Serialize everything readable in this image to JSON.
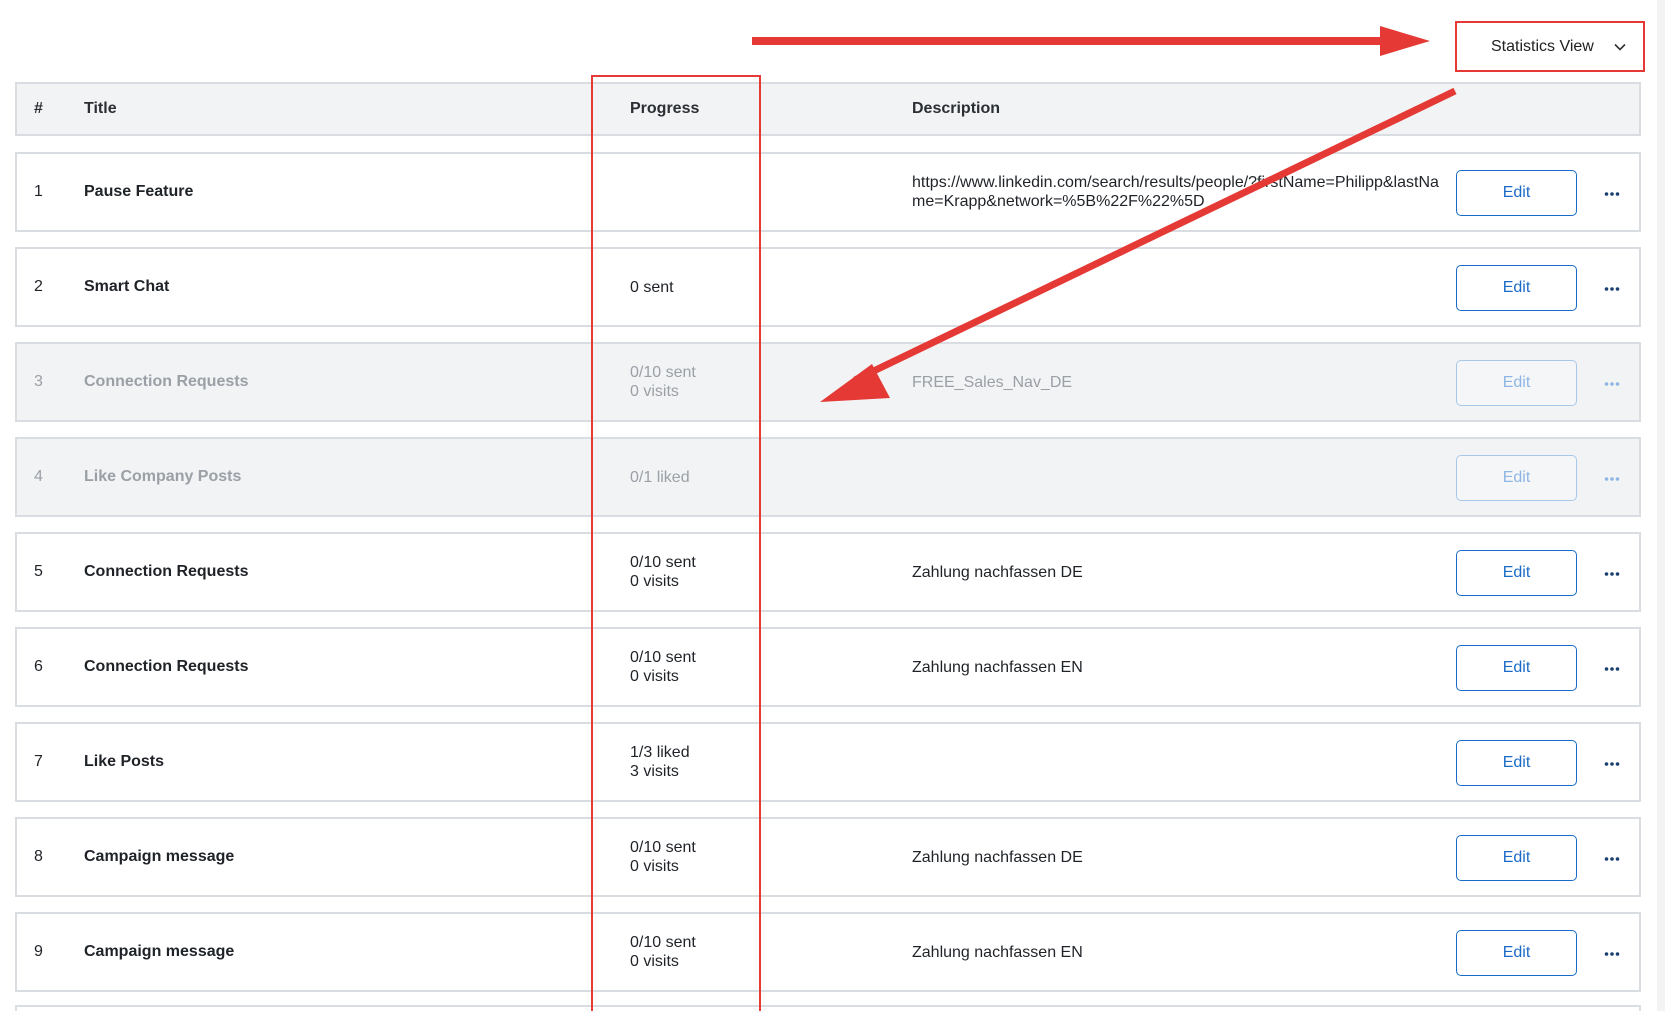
{
  "view_select": {
    "label": "Statistics View"
  },
  "table": {
    "headers": {
      "num": "#",
      "title": "Title",
      "progress": "Progress",
      "description": "Description"
    },
    "edit_label": "Edit",
    "rows": [
      {
        "num": "1",
        "title": "Pause Feature",
        "progress_line1": "",
        "progress_line2": "",
        "description": "https://www.linkedin.com/search/results/people/?firstName=Philipp&lastName=Krapp&network=%5B%22F%22%5D",
        "state": "active"
      },
      {
        "num": "2",
        "title": "Smart Chat",
        "progress_line1": "0 sent",
        "progress_line2": "",
        "description": "",
        "state": "active"
      },
      {
        "num": "3",
        "title": "Connection Requests",
        "progress_line1": "0/10 sent",
        "progress_line2": "0 visits",
        "description": "FREE_Sales_Nav_DE",
        "state": "paused"
      },
      {
        "num": "4",
        "title": "Like Company Posts",
        "progress_line1": "0/1 liked",
        "progress_line2": "",
        "description": "",
        "state": "paused"
      },
      {
        "num": "5",
        "title": "Connection Requests",
        "progress_line1": "0/10 sent",
        "progress_line2": "0 visits",
        "description": "Zahlung nachfassen DE",
        "state": "active"
      },
      {
        "num": "6",
        "title": "Connection Requests",
        "progress_line1": "0/10 sent",
        "progress_line2": "0 visits",
        "description": "Zahlung nachfassen EN",
        "state": "active"
      },
      {
        "num": "7",
        "title": "Like Posts",
        "progress_line1": "1/3 liked",
        "progress_line2": "3 visits",
        "description": "",
        "state": "active"
      },
      {
        "num": "8",
        "title": "Campaign message",
        "progress_line1": "0/10 sent",
        "progress_line2": "0 visits",
        "description": "Zahlung nachfassen DE",
        "state": "active"
      },
      {
        "num": "9",
        "title": "Campaign message",
        "progress_line1": "0/10 sent",
        "progress_line2": "0 visits",
        "description": "Zahlung nachfassen EN",
        "state": "active"
      }
    ]
  },
  "colors": {
    "annotation_red": "#e53935",
    "link_blue": "#1a6bc7",
    "muted_bg": "#f2f3f5"
  },
  "icons": {
    "dropdown": "chevron-down-icon",
    "row_menu": "more-horizontal-icon"
  }
}
